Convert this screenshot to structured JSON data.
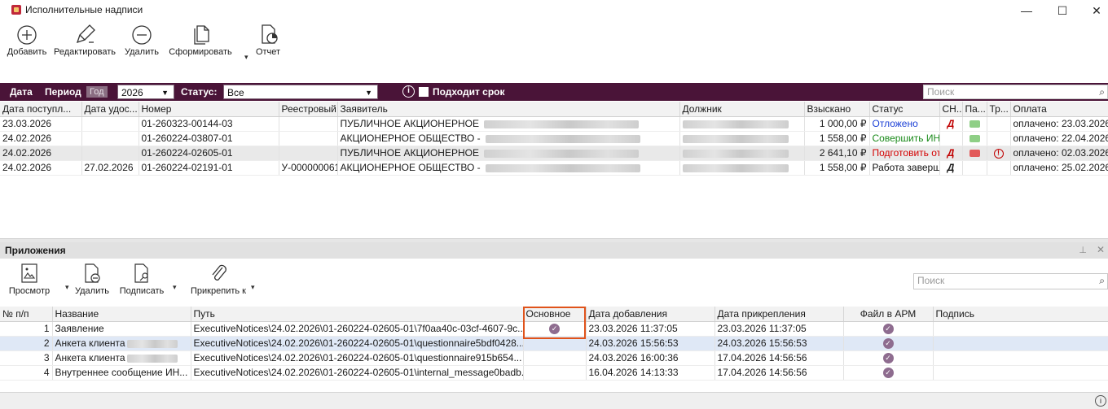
{
  "window": {
    "title": "Исполнительные надписи",
    "minimize": "—",
    "maximize": "☐",
    "close": "✕"
  },
  "toolbar": {
    "add": "Добавить",
    "edit": "Редактировать",
    "delete": "Удалить",
    "generate": "Сформировать",
    "report": "Отчет"
  },
  "filter": {
    "date_label": "Дата",
    "period_label": "Период",
    "period_value": "Год",
    "year": "2026",
    "status_label": "Статус:",
    "status_value": "Все",
    "deadline_label": "Подходит срок",
    "search_placeholder": "Поиск"
  },
  "main_table": {
    "columns": [
      "Дата поступл...",
      "Дата удос...",
      "Номер",
      "Реестровый...",
      "Заявитель",
      "Должник",
      "Взыскано",
      "Статус",
      "СН...",
      "Па...",
      "Тр...",
      "Оплата"
    ],
    "rows": [
      {
        "received": "23.03.2026",
        "certified": "",
        "number": "01-260323-00144-03",
        "registry": "",
        "applicant": "ПУБЛИЧНОЕ АКЦИОНЕРНОЕ",
        "debtor": "",
        "amount": "1 000,00 ₽",
        "status": "Отложено",
        "status_color": "#1a3fd6",
        "sn": "Д",
        "sn_style": "red",
        "pa_color": "#8fcf86",
        "tr_warn": false,
        "payment": "оплачено: 23.03.2026"
      },
      {
        "received": "24.02.2026",
        "certified": "",
        "number": "01-260224-03807-01",
        "registry": "",
        "applicant": "АКЦИОНЕРНОЕ ОБЩЕСТВО -",
        "debtor": "",
        "amount": "1 558,00 ₽",
        "status": "Совершить ИН",
        "status_color": "#1a8a1a",
        "sn": "",
        "sn_style": "",
        "pa_color": "#8fcf86",
        "tr_warn": false,
        "payment": "оплачено: 22.04.2026"
      },
      {
        "received": "24.02.2026",
        "certified": "",
        "number": "01-260224-02605-01",
        "registry": "",
        "applicant": "ПУБЛИЧНОЕ АКЦИОНЕРНОЕ",
        "debtor": "",
        "amount": "2 641,10 ₽",
        "status": "Подготовить от...",
        "status_color": "#d40000",
        "sn": "Д",
        "sn_style": "red",
        "pa_color": "#e25a5a",
        "tr_warn": true,
        "payment": "оплачено: 02.03.2026"
      },
      {
        "received": "24.02.2026",
        "certified": "27.02.2026",
        "number": "01-260224-02191-01",
        "registry": "У-0000000611",
        "applicant": "АКЦИОНЕРНОЕ ОБЩЕСТВО -",
        "debtor": "",
        "amount": "1 558,00 ₽",
        "status": "Работа заверше...",
        "status_color": "#111111",
        "sn": "Д",
        "sn_style": "bold",
        "pa_color": "",
        "tr_warn": false,
        "payment": "оплачено: 25.02.2026"
      }
    ]
  },
  "attachments": {
    "panel_title": "Приложения",
    "pin": "⊥",
    "close": "✕",
    "toolbar": {
      "view": "Просмотр",
      "delete": "Удалить",
      "sign": "Подписать",
      "attach": "Прикрепить к"
    },
    "search_placeholder": "Поиск",
    "columns": [
      "№ п/п",
      "Название",
      "Путь",
      "Основное",
      "Дата добавления",
      "Дата прикрепления",
      "Файл в АРМ",
      "Подпись"
    ],
    "rows": [
      {
        "n": "1",
        "name": "Заявление",
        "name_blur": false,
        "path": "ExecutiveNotices\\24.02.2026\\01-260224-02605-01\\7f0aa40c-03cf-4607-9c...",
        "main": true,
        "added": "23.03.2026 11:37:05",
        "attached": "23.03.2026 11:37:05",
        "in_arm": true,
        "signature": ""
      },
      {
        "n": "2",
        "name": "Анкета клиента",
        "name_blur": true,
        "path": "ExecutiveNotices\\24.02.2026\\01-260224-02605-01\\questionnaire5bdf0428...",
        "main": false,
        "added": "24.03.2026 15:56:53",
        "attached": "24.03.2026 15:56:53",
        "in_arm": true,
        "signature": ""
      },
      {
        "n": "3",
        "name": "Анкета клиента",
        "name_blur": true,
        "path": "ExecutiveNotices\\24.02.2026\\01-260224-02605-01\\questionnaire915b654...",
        "main": false,
        "added": "24.03.2026 16:00:36",
        "attached": "17.04.2026 14:56:56",
        "in_arm": true,
        "signature": ""
      },
      {
        "n": "4",
        "name": "Внутреннее сообщение ИН...",
        "name_blur": false,
        "path": "ExecutiveNotices\\24.02.2026\\01-260224-02605-01\\internal_message0badb...",
        "main": false,
        "added": "16.04.2026 14:13:33",
        "attached": "17.04.2026 14:56:56",
        "in_arm": true,
        "signature": ""
      }
    ]
  },
  "statusbar": {
    "info": "i"
  },
  "colors": {
    "accent": "#4a1438",
    "check": "#8e6c8f",
    "highlight": "#e0531b"
  }
}
